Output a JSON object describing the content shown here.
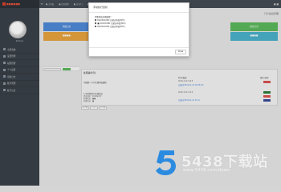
{
  "app": {
    "logo_text": "■■■■■■",
    "user_name": "Kolmyx",
    "menu_icon": "hamburger-icon"
  },
  "topbar": {
    "crumbs": [
      "■ 主页面",
      "■ 首页管理",
      "■ 业务/门",
      "■ 业务门"
    ],
    "right_text": "■ ■"
  },
  "sidebar": {
    "items": [
      {
        "label": "全部系统"
      },
      {
        "label": "设置管理"
      },
      {
        "label": "权限管理"
      },
      {
        "label": "个人设置"
      },
      {
        "label": "审核日志"
      },
      {
        "label": "账户管理"
      },
      {
        "label": "帐号记录"
      }
    ]
  },
  "page": {
    "header_right": "门户后台管理"
  },
  "tiles": [
    {
      "label": "系统日志",
      "color": "#4f89d6"
    },
    {
      "label": "提交记录",
      "color": "#5cb85c"
    },
    {
      "label": "■■■■",
      "color": "#4ab0c9"
    },
    {
      "label": "■■■■",
      "color": "#e6a33e"
    }
  ],
  "panel": {
    "title": "处理事件/列",
    "columns": [
      "时间/描述",
      "操作/选项"
    ],
    "rows": [
      {
        "label": "中国第一门户在线审核通知",
        "time": "2019-11-21 14:5",
        "link": "已通过(2019-11-21 16:33:22)",
        "button_color": "#d9534f"
      },
      {
        "label": "1.全系统用户在线信息",
        "sub": [
          "提交时间：2019年X月",
          "处理状态：■■",
          "处理记录：■"
        ],
        "time": "2019-11-21 14:5",
        "link": "已通过(2019-11-21 15:1)",
        "buttons": [
          "#2f7d3a",
          "#d9534f",
          "#3b4a9a"
        ]
      }
    ]
  },
  "pager": [
    "上一页",
    "1",
    "下一页"
  ],
  "modal": {
    "title": "手动执行目标",
    "body_title": "需要审核处理通知？",
    "items": [
      "MAXXXX-MD 已通过审核(3PC)",
      "■ XXXXX-MD 已通过审核(3PC)",
      "MAXXXX-MD 已通过审核(3PC)"
    ],
    "close_label": "Close"
  },
  "watermark": {
    "title": "5438下载站",
    "url": "www.5438.com/down"
  }
}
